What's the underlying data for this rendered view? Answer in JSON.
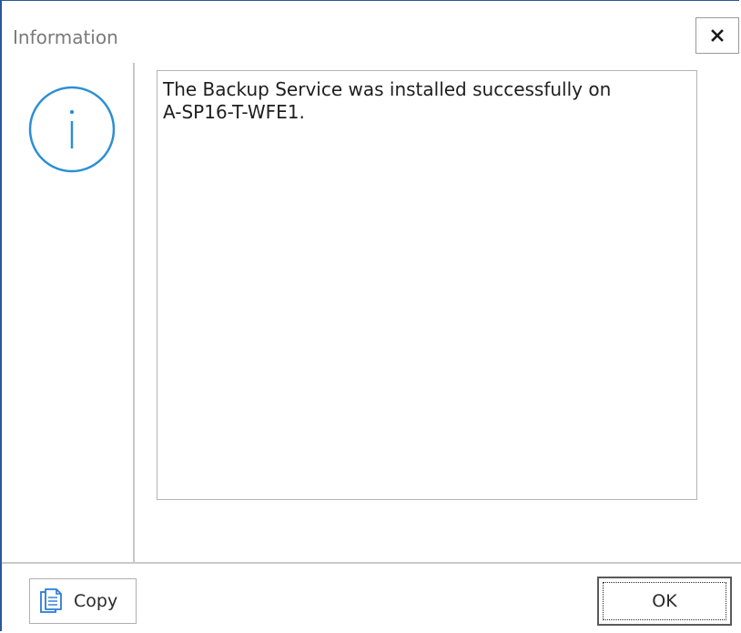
{
  "dialog": {
    "title": "Information",
    "message": "The Backup Service was installed successfully on\nA-SP16-T-WFE1.",
    "icon": "info-circle-icon",
    "accent_color": "#2b8fd6"
  },
  "buttons": {
    "copy_label": "Copy",
    "ok_label": "OK"
  }
}
